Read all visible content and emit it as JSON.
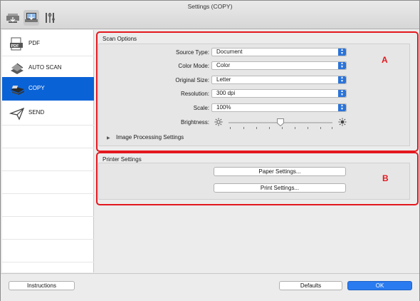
{
  "window": {
    "title": "Settings (COPY)"
  },
  "toolbar": {
    "items": [
      {
        "icon": "scan-settings-icon"
      },
      {
        "icon": "general-settings-icon"
      },
      {
        "icon": "tools-icon"
      }
    ]
  },
  "sidebar": {
    "items": [
      {
        "label": "PDF",
        "icon": "pdf-icon"
      },
      {
        "label": "AUTO SCAN",
        "icon": "auto-scan-icon"
      },
      {
        "label": "COPY",
        "icon": "copy-icon",
        "selected": true
      },
      {
        "label": "SEND",
        "icon": "send-icon"
      }
    ]
  },
  "scan_options": {
    "title": "Scan Options",
    "source_type": {
      "label": "Source Type:",
      "value": "Document"
    },
    "color_mode": {
      "label": "Color Mode:",
      "value": "Color"
    },
    "original_size": {
      "label": "Original Size:",
      "value": "Letter"
    },
    "resolution": {
      "label": "Resolution:",
      "value": "300 dpi"
    },
    "scale": {
      "label": "Scale:",
      "value": "100%"
    },
    "brightness": {
      "label": "Brightness:",
      "level": 0.5
    },
    "image_processing": {
      "label": "Image Processing Settings"
    }
  },
  "printer_settings": {
    "title": "Printer Settings",
    "paper_button": "Paper Settings...",
    "print_button": "Print Settings..."
  },
  "annotations": {
    "a": "A",
    "b": "B",
    "color": "#e3181f"
  },
  "footer": {
    "instructions": "Instructions",
    "defaults": "Defaults",
    "ok": "OK"
  },
  "colors": {
    "accent": "#0a63d6",
    "highlight_box": "#e3181f"
  }
}
